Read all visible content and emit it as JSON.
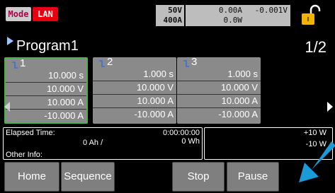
{
  "status": {
    "mode_label": "Mode",
    "lan_label": "LAN",
    "rating_voltage": "50V",
    "rating_current": "400A",
    "meas_current": "0.00A",
    "meas_voltage": "-0.001V",
    "meas_power": "0.0W"
  },
  "program": {
    "title": "Program1",
    "page": "1/2"
  },
  "steps": [
    {
      "num": "1",
      "time": "10.000 s",
      "voltage": "10.000 V",
      "current_a": "10.000 A",
      "current_b": "-10.000 A"
    },
    {
      "num": "2",
      "time": "1.000 s",
      "voltage": "10.000 V",
      "current_a": "10.000 A",
      "current_b": "-10.000 A"
    },
    {
      "num": "3",
      "time": "1.000 s",
      "voltage": "10.000 V",
      "current_a": "10.000 A",
      "current_b": "-10.000 A"
    }
  ],
  "info": {
    "elapsed_label": "Elapsed Time:",
    "elapsed_value": "0:00:00:00",
    "ah_value": "0 Ah /",
    "wh_value": "0 Wh",
    "other_label": "Other Info:",
    "power_1": "+10 W",
    "power_2": "-10 W"
  },
  "buttons": {
    "home": "Home",
    "sequence": "Sequence",
    "stop": "Stop",
    "pause": "Pause"
  },
  "colors": {
    "lan_badge": "#e60012",
    "selected_border": "#4caf50",
    "lock_icon": "#f0b400",
    "pointer_arrow": "#1a9ad6"
  }
}
